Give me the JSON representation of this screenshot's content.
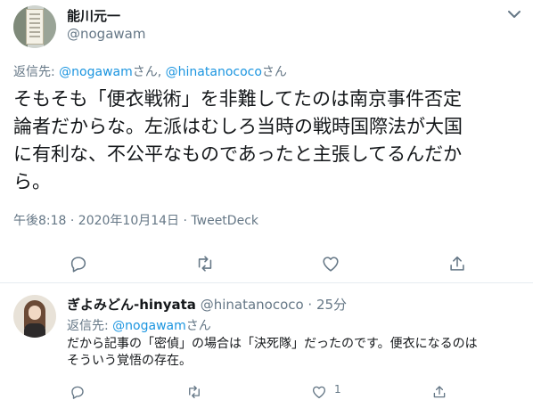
{
  "main_tweet": {
    "display_name": "能川元一",
    "handle": "@nogawam",
    "reply_label": "返信先: ",
    "reply_user1": "@nogawam",
    "reply_sep1": "さん, ",
    "reply_user2": "@hinatanococo",
    "reply_sep2": "さん",
    "text_lines": [
      "そもそも「便衣戦術」を非難してたのは南京事件否定",
      "論者だからな。左派はむしろ当時の戦時国際法が大国",
      "に有利な、不公平なものであったと主張してるんだか",
      "ら。"
    ],
    "meta": "午後8:18 · 2020年10月14日 · TweetDeck",
    "icons": [
      "reply-icon",
      "retweet-icon",
      "like-icon",
      "share-icon"
    ]
  },
  "reply_tweet": {
    "display_name": "ぎよみどん-hinyata",
    "handle_time": " @hinatanococo · 25分",
    "reply_label": "返信先: ",
    "reply_user": "@nogawam",
    "reply_sep": "さん",
    "text_lines": [
      "だから記事の「密偵」の場合は「決死隊」だったのです。便衣になるのは",
      "そういう覚悟の存在。"
    ],
    "like_count": "1",
    "icons": [
      "reply-icon",
      "retweet-icon",
      "like-icon",
      "share-icon"
    ]
  },
  "colors": {
    "link": "#1b95e0",
    "secondary": "#657786",
    "text": "#14171a",
    "divider": "#e6ecf0"
  }
}
